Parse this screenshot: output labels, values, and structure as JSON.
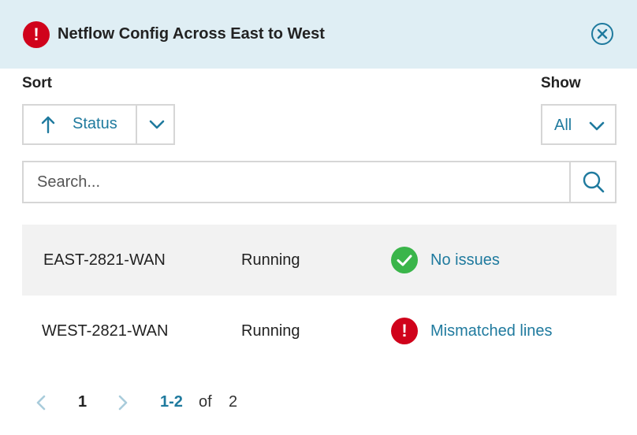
{
  "header": {
    "title": "Netflow Config Across East to West",
    "icon": "error-icon",
    "close_icon": "close-icon",
    "accent": "#d0021b",
    "background": "#dfeef4"
  },
  "sort": {
    "label": "Sort",
    "value": "Status",
    "direction": "ascending"
  },
  "show": {
    "label": "Show",
    "value": "All"
  },
  "search": {
    "placeholder": "Search...",
    "value": ""
  },
  "rows": [
    {
      "name": "EAST-2821-WAN",
      "state": "Running",
      "status": "No issues",
      "status_icon": "check-circle-icon",
      "status_color": "#3ab54a"
    },
    {
      "name": "WEST-2821-WAN",
      "state": "Running",
      "status": "Mismatched lines",
      "status_icon": "error-icon",
      "status_color": "#d0021b"
    }
  ],
  "pagination": {
    "current_page": "1",
    "range": "1-2",
    "of_label": "of",
    "total": "2"
  },
  "colors": {
    "link": "#1f7a9e",
    "border": "#d6d6d6",
    "row_alt": "#f2f2f2"
  }
}
